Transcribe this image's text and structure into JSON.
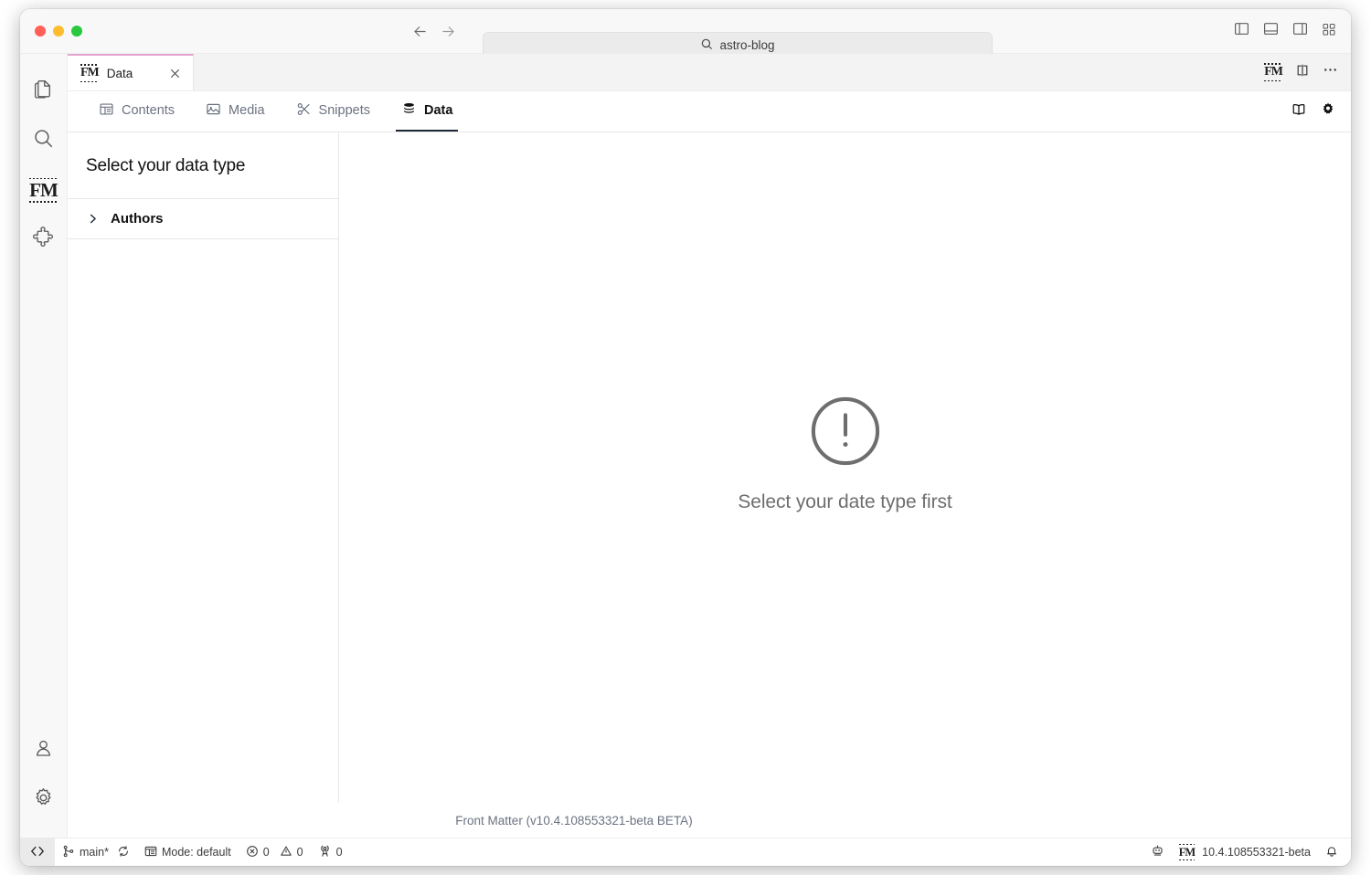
{
  "window": {
    "traffic_lights": [
      "close",
      "minimize",
      "maximize"
    ],
    "colors": {
      "close": "#ff5f57",
      "minimize": "#febc2e",
      "maximize": "#28c840",
      "tab_accent": "#e3a7cf",
      "active_tab_underline": "#1f2937",
      "muted_text": "#6b7280"
    }
  },
  "titlebar": {
    "back_icon": "arrow-left-icon",
    "forward_icon": "arrow-right-icon",
    "search": {
      "icon": "search-icon",
      "value": "astro-blog"
    },
    "layout_buttons": [
      {
        "name": "toggle-primary-sidebar",
        "icon": "layout-sidebar-left-icon"
      },
      {
        "name": "toggle-panel",
        "icon": "layout-panel-bottom-icon"
      },
      {
        "name": "toggle-secondary-sidebar",
        "icon": "layout-sidebar-right-icon"
      },
      {
        "name": "customize-layout",
        "icon": "layout-grid-icon"
      }
    ]
  },
  "activitybar": {
    "top_items": [
      {
        "name": "explorer",
        "icon": "files-icon"
      },
      {
        "name": "search",
        "icon": "search-icon"
      },
      {
        "name": "front-matter",
        "icon": "fm-logo-icon",
        "label": "FM"
      },
      {
        "name": "extensions",
        "icon": "extensions-puzzle-icon"
      }
    ],
    "bottom_items": [
      {
        "name": "accounts",
        "icon": "account-person-icon"
      },
      {
        "name": "manage-settings",
        "icon": "gear-icon"
      }
    ]
  },
  "tabstrip": {
    "tabs": [
      {
        "label": "Data",
        "icon": "fm-logo-icon",
        "icon_label": "FM",
        "close_icon": "close-icon",
        "active": true
      }
    ],
    "actions": [
      {
        "name": "front-matter-action",
        "icon": "fm-logo-icon",
        "label": "FM"
      },
      {
        "name": "split-editor",
        "icon": "split-editor-icon"
      },
      {
        "name": "more-actions",
        "icon": "ellipsis-icon"
      }
    ]
  },
  "frontmatter": {
    "nav": [
      {
        "label": "Contents",
        "icon": "contents-layout-icon",
        "active": false
      },
      {
        "label": "Media",
        "icon": "image-icon",
        "active": false
      },
      {
        "label": "Snippets",
        "icon": "scissors-icon",
        "active": false
      },
      {
        "label": "Data",
        "icon": "database-icon",
        "active": true
      }
    ],
    "nav_actions": [
      {
        "name": "documentation",
        "icon": "book-icon"
      },
      {
        "name": "settings",
        "icon": "gear-icon"
      }
    ],
    "data_panel": {
      "heading": "Select your data type",
      "items": [
        {
          "label": "Authors",
          "icon": "chevron-right-icon",
          "expanded": false
        }
      ]
    },
    "empty_state": {
      "icon": "exclamation-circle-icon",
      "message": "Select your date type first"
    },
    "footer": "Front Matter (v10.4.108553321-beta BETA)"
  },
  "statusbar": {
    "remote_icon": "remote-window-icon",
    "branch": {
      "icon": "source-control-branch-icon",
      "label": "main*",
      "sync_icon": "sync-icon"
    },
    "mode": {
      "icon": "mode-window-icon",
      "label": "Mode: default"
    },
    "problems": {
      "error_icon": "error-circle-icon",
      "errors": "0",
      "warning_icon": "warning-triangle-icon",
      "warnings": "0"
    },
    "ports": {
      "icon": "radio-tower-icon",
      "count": "0"
    },
    "right": {
      "copilot_icon": "copilot-robot-icon",
      "fm_icon": "fm-logo-icon",
      "fm_label": "FM",
      "fm_version": "10.4.108553321-beta",
      "bell_icon": "bell-icon"
    }
  }
}
